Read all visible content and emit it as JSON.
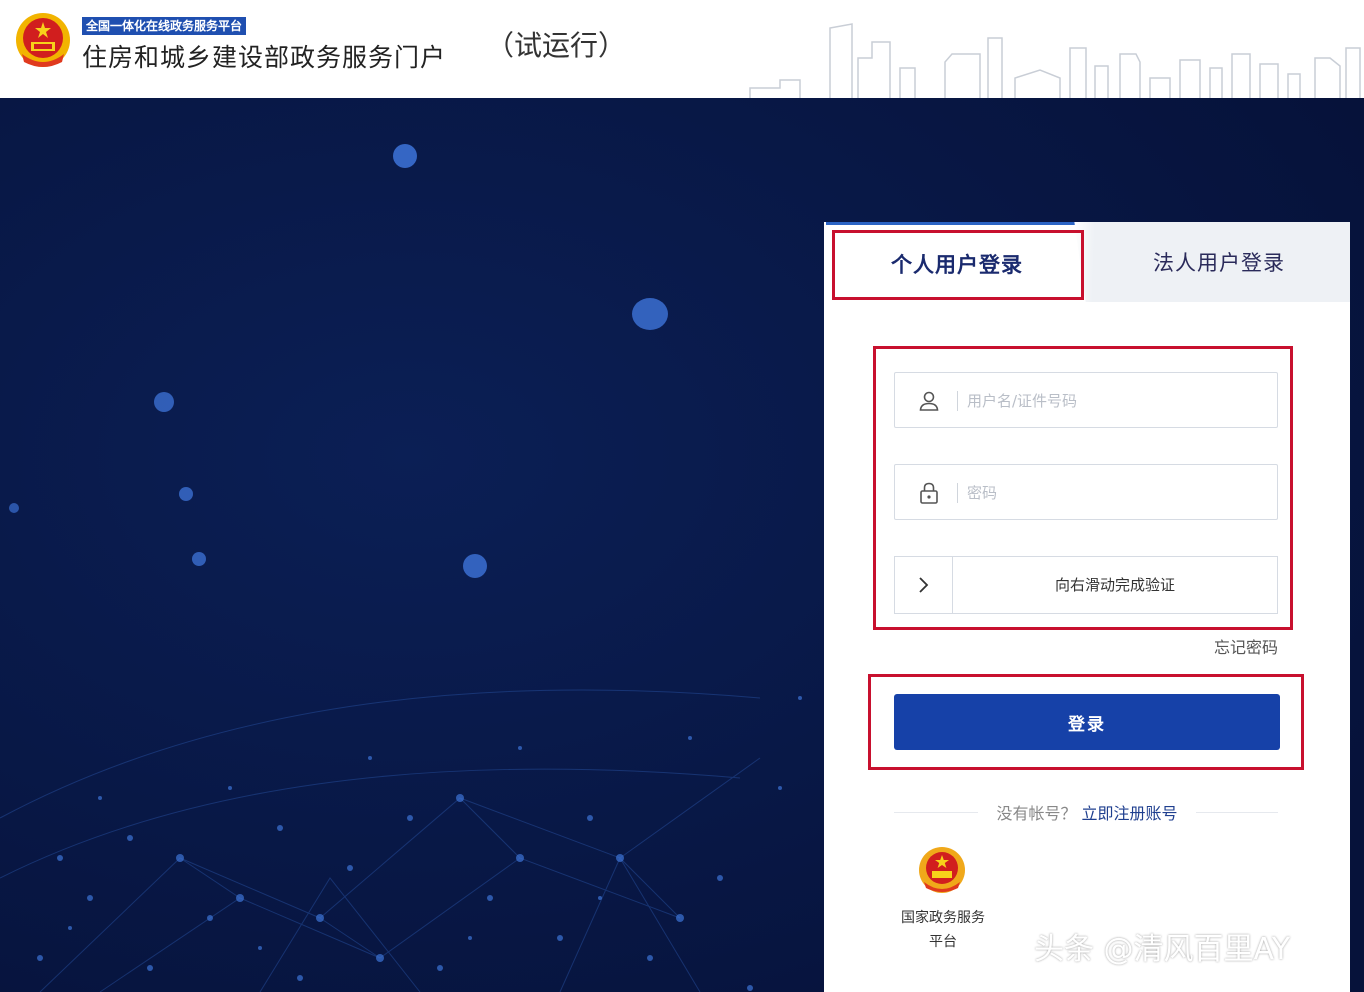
{
  "header": {
    "platform_tag": "全国一体化在线政务服务平台",
    "portal_title": "住房和城乡建设部政务服务门户",
    "trial_label": "（试运行）",
    "emblem_icon": "national-emblem-icon"
  },
  "login": {
    "tabs": [
      {
        "label": "个人用户登录",
        "active": true
      },
      {
        "label": "法人用户登录",
        "active": false
      }
    ],
    "username": {
      "placeholder": "用户名/证件号码",
      "icon": "user-icon"
    },
    "password": {
      "placeholder": "密码",
      "icon": "lock-icon"
    },
    "slider": {
      "text": "向右滑动完成验证",
      "icon": "chevron-right-icon"
    },
    "forgot_password": "忘记密码",
    "login_button": "登录",
    "no_account_text": "没有帐号？",
    "register_link": "立即注册账号",
    "gov_platform_line1": "国家政务服务",
    "gov_platform_line2": "平台"
  },
  "watermark": "头条 @清风百里AY",
  "colors": {
    "background": "#0a1a45",
    "primary_button": "#1641a8",
    "highlight_box": "#c8102e",
    "platform_tag": "#1f4fb0"
  }
}
